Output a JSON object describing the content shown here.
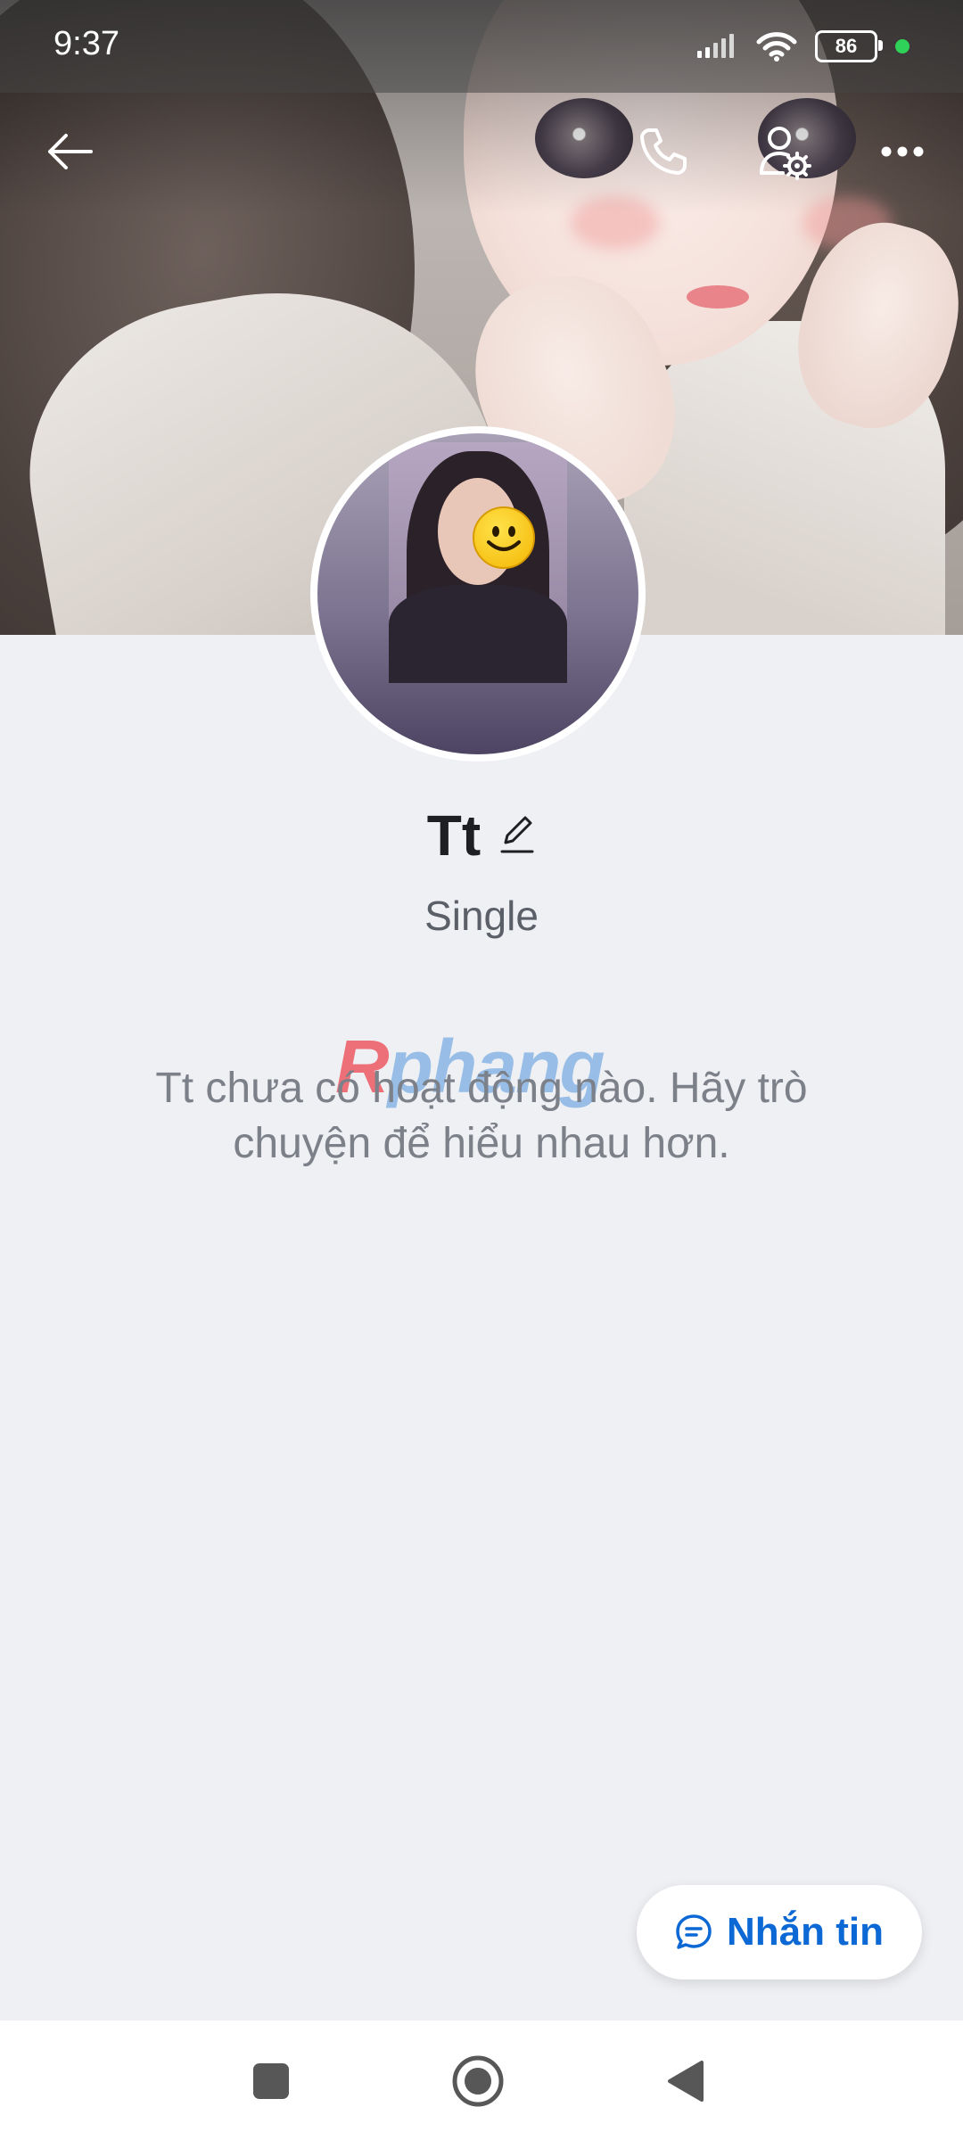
{
  "status_bar": {
    "time": "9:37",
    "battery": "86",
    "icons": [
      "signal-icon",
      "wifi-icon",
      "battery-icon",
      "privacy-indicator-dot"
    ]
  },
  "header": {
    "icons": [
      "back-arrow-icon",
      "phone-icon",
      "user-settings-icon",
      "more-icon"
    ]
  },
  "profile": {
    "name": "Tt",
    "bio": "Single"
  },
  "watermark": {
    "part1": "R",
    "part2": "phang"
  },
  "empty_state": {
    "line1": "Tt chưa có hoạt động nào. Hãy trò",
    "line2": "chuyện để hiểu nhau hơn."
  },
  "message_button": {
    "label": "Nhắn tin",
    "icon": "chat-bubble-icon"
  },
  "nav_bar": {
    "icons": [
      "recents-square-icon",
      "home-circle-icon",
      "back-triangle-icon"
    ]
  },
  "colors": {
    "accent": "#0b68d4",
    "background": "#eff0f4",
    "text_primary": "#1d1f23",
    "text_secondary": "#7c8089"
  }
}
